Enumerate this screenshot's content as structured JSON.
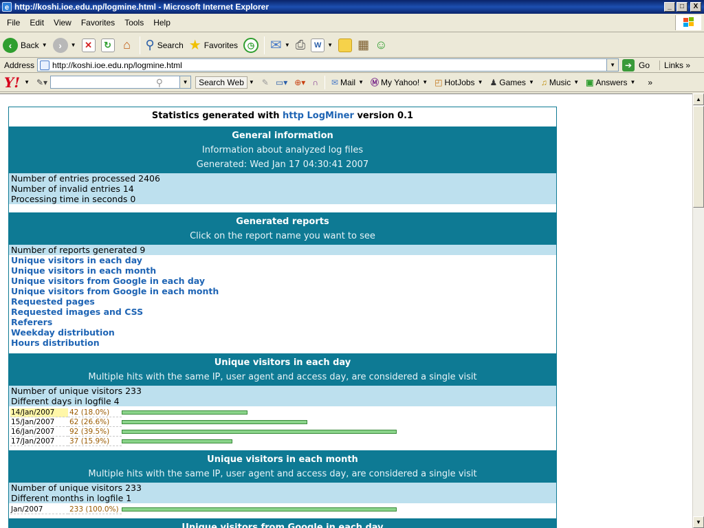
{
  "window": {
    "title": "http://koshi.ioe.edu.np/logmine.html - Microsoft Internet Explorer",
    "min_label": "_",
    "max_label": "□",
    "close_label": "X"
  },
  "menu": [
    "File",
    "Edit",
    "View",
    "Favorites",
    "Tools",
    "Help"
  ],
  "toolbar": {
    "back_label": "Back",
    "search_label": "Search",
    "favorites_label": "Favorites"
  },
  "address": {
    "label": "Address",
    "url": "http://koshi.ioe.edu.np/logmine.html",
    "go_label": "Go",
    "links_label": "Links"
  },
  "yahoo": {
    "logo": "Y!",
    "search_placeholder": "",
    "search_web_label": "Search Web",
    "mail_label": "Mail",
    "myyahoo_label": "My Yahoo!",
    "hotjobs_label": "HotJobs",
    "games_label": "Games",
    "music_label": "Music",
    "answers_label": "Answers",
    "more_label": "»"
  },
  "page": {
    "header_prefix": "Statistics generated with",
    "header_link": "http LogMiner",
    "header_suffix": "version 0.1",
    "general": {
      "title": "General information",
      "subtitle": "Information about analyzed log files",
      "generated": "Generated: Wed Jan 17 04:30:41 2007",
      "rows": [
        "Number of entries processed 2406",
        "Number of invalid entries 14",
        "Processing time in seconds 0"
      ]
    },
    "reports": {
      "title": "Generated reports",
      "subtitle": "Click on the report name you want to see",
      "count_text": "Number of reports generated 9",
      "links": [
        "Unique visitors in each day",
        "Unique visitors in each month",
        "Unique visitors from Google in each day",
        "Unique visitors from Google in each month",
        "Requested pages",
        "Requested images and CSS",
        "Referers",
        "Weekday distribution",
        "Hours distribution"
      ]
    },
    "daily": {
      "title": "Unique visitors in each day",
      "subtitle": "Multiple hits with the same IP, user agent and access day, are considered a single visit",
      "rows": [
        "Number of unique visitors 233",
        "Different days in logfile 4"
      ],
      "bars": [
        {
          "label": "14/Jan/2007",
          "count": "42 (18.0%)",
          "value": 42
        },
        {
          "label": "15/Jan/2007",
          "count": "62 (26.6%)",
          "value": 62
        },
        {
          "label": "16/Jan/2007",
          "count": "92 (39.5%)",
          "value": 92
        },
        {
          "label": "17/Jan/2007",
          "count": "37 (15.9%)",
          "value": 37
        }
      ],
      "max": 92
    },
    "monthly": {
      "title": "Unique visitors in each month",
      "subtitle": "Multiple hits with the same IP, user agent and access day, are considered a single visit",
      "rows": [
        "Number of unique visitors 233",
        "Different months in logfile 1"
      ],
      "bars": [
        {
          "label": "Jan/2007",
          "count": "233 (100.0%)",
          "value": 233
        }
      ],
      "max": 233
    },
    "google_daily": {
      "title": "Unique visitors from Google in each day"
    }
  }
}
